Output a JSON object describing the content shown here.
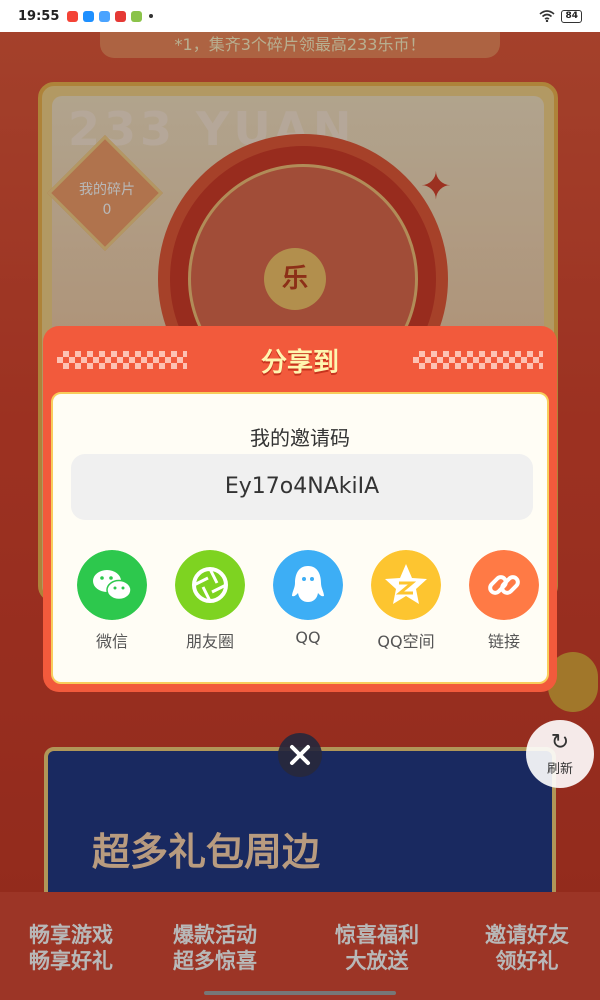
{
  "status_bar": {
    "time": "19:55",
    "battery": "84",
    "app_icon_colors": [
      "#f44336",
      "#1e90ff",
      "#4aa3ff",
      "#e53935",
      "#8bc34a"
    ]
  },
  "background": {
    "banner_text": "*1，集齐3个碎片领最高233乐币！",
    "watermark": "233 YUAN",
    "fragment_label": "我的碎片",
    "fragment_count": "0",
    "wheel_center": "乐",
    "games_banner_title": "超多礼包周边",
    "features": [
      {
        "line1": "畅享游戏",
        "line2": "畅享好礼"
      },
      {
        "line1": "爆款活动",
        "line2": "超多惊喜"
      },
      {
        "line1": "惊喜福利",
        "line2": "大放送"
      },
      {
        "line1": "邀请好友",
        "line2": "领好礼"
      }
    ]
  },
  "dialog": {
    "title": "分享到",
    "invite_label": "我的邀请码",
    "invite_code": "Ey17o4NAkiIA",
    "share_options": [
      {
        "label": "微信",
        "icon": "wechat-icon",
        "color": "#2dc84d"
      },
      {
        "label": "朋友圈",
        "icon": "moments-icon",
        "color": "#7ed321"
      },
      {
        "label": "QQ",
        "icon": "qq-icon",
        "color": "#3daef5"
      },
      {
        "label": "QQ空间",
        "icon": "qzone-icon",
        "color": "#fdc530"
      },
      {
        "label": "链接",
        "icon": "link-icon",
        "color": "#ff7a45"
      }
    ]
  },
  "refresh_label": "刷新",
  "colors": {
    "dialog_header": "#f25a3c",
    "dialog_title": "#fff6b0",
    "dialog_border": "#f8cd5c"
  }
}
